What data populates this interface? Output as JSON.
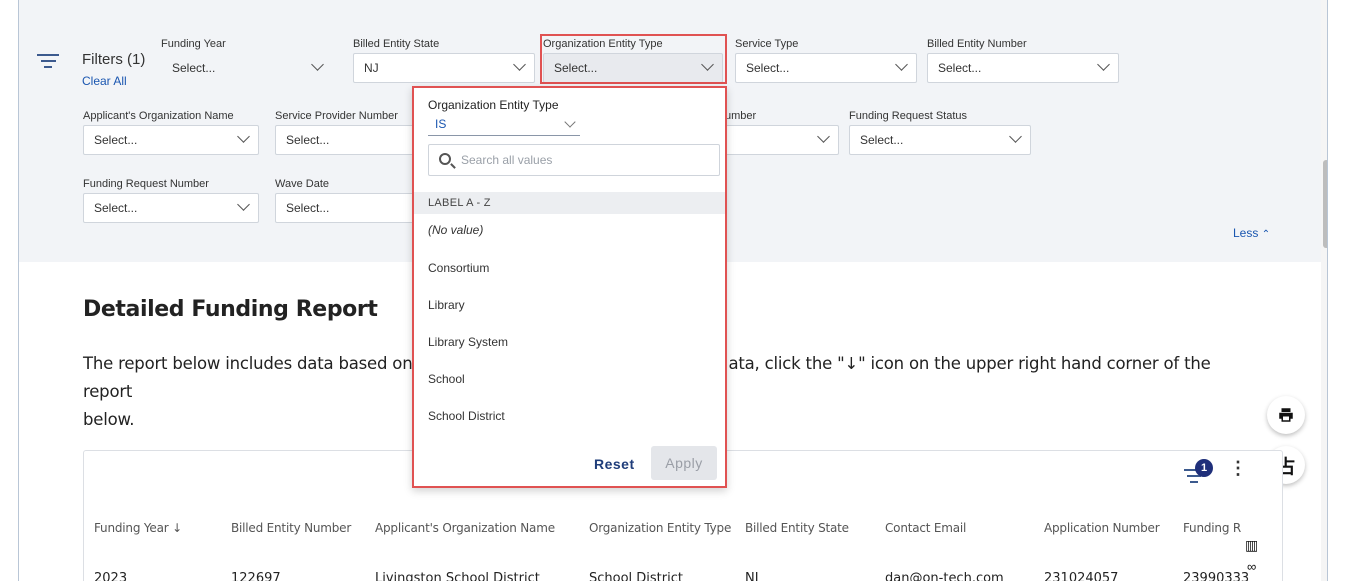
{
  "filters": {
    "title": "Filters (1)",
    "clear_all": "Clear All",
    "less": "Less",
    "fields": [
      {
        "label": "Funding Year",
        "value": "Select..."
      },
      {
        "label": "Billed Entity State",
        "value": "NJ"
      },
      {
        "label": "Organization Entity Type",
        "value": "Select..."
      },
      {
        "label": "Service Type",
        "value": "Select..."
      },
      {
        "label": "Billed Entity Number",
        "value": "Select..."
      },
      {
        "label": "Applicant's Organization Name",
        "value": "Select..."
      },
      {
        "label": "Service Provider Number",
        "value": "Select..."
      },
      {
        "label": "umber",
        "value": "Select..."
      },
      {
        "label": "Funding Request Status",
        "value": "Select..."
      },
      {
        "label": "Funding Request Number",
        "value": "Select..."
      },
      {
        "label": "Wave Date",
        "value": "Select..."
      }
    ]
  },
  "dropdown": {
    "title": "Organization Entity Type",
    "operator": "IS",
    "search_placeholder": "Search all values",
    "section_label": "LABEL A - Z",
    "options": [
      "(No value)",
      "Consortium",
      "Library",
      "Library System",
      "School",
      "School District"
    ],
    "reset_label": "Reset",
    "apply_label": "Apply"
  },
  "report": {
    "title": "Detailed Funding Report",
    "description_left": "The report below includes data based on",
    "description_right": "ata, click the \"↓\" icon on the upper right hand corner of the report",
    "description_line2": "below."
  },
  "table": {
    "filter_badge": "1",
    "more_icon": "⋮",
    "columns": [
      "Funding Year ↓",
      "Billed Entity Number",
      "Applicant's Organization Name",
      "Organization Entity Type",
      "Billed Entity State",
      "Contact Email",
      "Application Number",
      "Funding R"
    ],
    "row": [
      "2023",
      "122697",
      "Livingston School District",
      "School District",
      "NJ",
      "dan@on-tech.com",
      "231024057",
      "23990333"
    ]
  },
  "icons": {
    "print": "print-icon",
    "presentation": "presentation-icon",
    "columns": "columns-icon",
    "filter": "filter-icon"
  },
  "colors": {
    "accent": "#1a56b0",
    "highlight": "#e05252",
    "badge": "#1f2f7a"
  }
}
